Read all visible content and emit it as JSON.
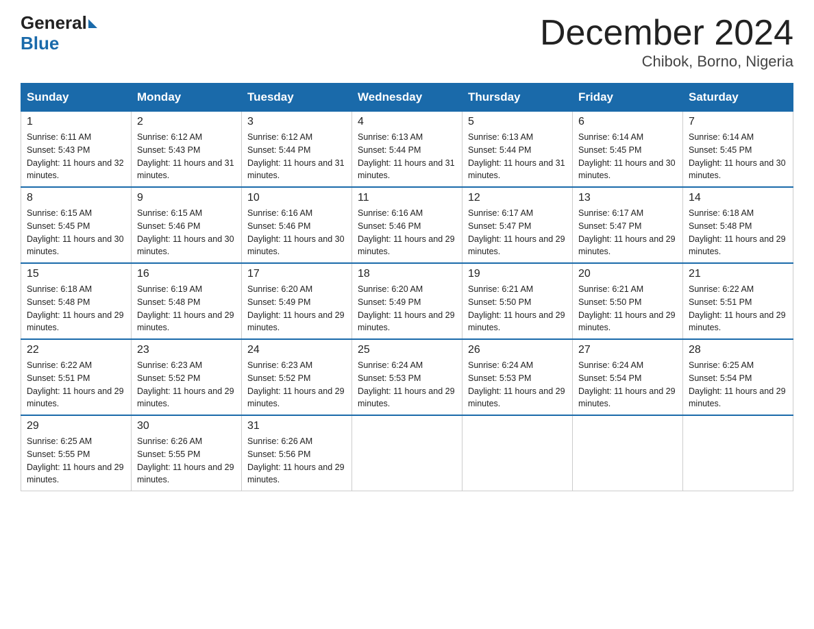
{
  "header": {
    "logo_general": "General",
    "logo_blue": "Blue",
    "month_title": "December 2024",
    "location": "Chibok, Borno, Nigeria"
  },
  "days_of_week": [
    "Sunday",
    "Monday",
    "Tuesday",
    "Wednesday",
    "Thursday",
    "Friday",
    "Saturday"
  ],
  "weeks": [
    [
      {
        "day": "1",
        "sunrise": "6:11 AM",
        "sunset": "5:43 PM",
        "daylight": "11 hours and 32 minutes."
      },
      {
        "day": "2",
        "sunrise": "6:12 AM",
        "sunset": "5:43 PM",
        "daylight": "11 hours and 31 minutes."
      },
      {
        "day": "3",
        "sunrise": "6:12 AM",
        "sunset": "5:44 PM",
        "daylight": "11 hours and 31 minutes."
      },
      {
        "day": "4",
        "sunrise": "6:13 AM",
        "sunset": "5:44 PM",
        "daylight": "11 hours and 31 minutes."
      },
      {
        "day": "5",
        "sunrise": "6:13 AM",
        "sunset": "5:44 PM",
        "daylight": "11 hours and 31 minutes."
      },
      {
        "day": "6",
        "sunrise": "6:14 AM",
        "sunset": "5:45 PM",
        "daylight": "11 hours and 30 minutes."
      },
      {
        "day": "7",
        "sunrise": "6:14 AM",
        "sunset": "5:45 PM",
        "daylight": "11 hours and 30 minutes."
      }
    ],
    [
      {
        "day": "8",
        "sunrise": "6:15 AM",
        "sunset": "5:45 PM",
        "daylight": "11 hours and 30 minutes."
      },
      {
        "day": "9",
        "sunrise": "6:15 AM",
        "sunset": "5:46 PM",
        "daylight": "11 hours and 30 minutes."
      },
      {
        "day": "10",
        "sunrise": "6:16 AM",
        "sunset": "5:46 PM",
        "daylight": "11 hours and 30 minutes."
      },
      {
        "day": "11",
        "sunrise": "6:16 AM",
        "sunset": "5:46 PM",
        "daylight": "11 hours and 29 minutes."
      },
      {
        "day": "12",
        "sunrise": "6:17 AM",
        "sunset": "5:47 PM",
        "daylight": "11 hours and 29 minutes."
      },
      {
        "day": "13",
        "sunrise": "6:17 AM",
        "sunset": "5:47 PM",
        "daylight": "11 hours and 29 minutes."
      },
      {
        "day": "14",
        "sunrise": "6:18 AM",
        "sunset": "5:48 PM",
        "daylight": "11 hours and 29 minutes."
      }
    ],
    [
      {
        "day": "15",
        "sunrise": "6:18 AM",
        "sunset": "5:48 PM",
        "daylight": "11 hours and 29 minutes."
      },
      {
        "day": "16",
        "sunrise": "6:19 AM",
        "sunset": "5:48 PM",
        "daylight": "11 hours and 29 minutes."
      },
      {
        "day": "17",
        "sunrise": "6:20 AM",
        "sunset": "5:49 PM",
        "daylight": "11 hours and 29 minutes."
      },
      {
        "day": "18",
        "sunrise": "6:20 AM",
        "sunset": "5:49 PM",
        "daylight": "11 hours and 29 minutes."
      },
      {
        "day": "19",
        "sunrise": "6:21 AM",
        "sunset": "5:50 PM",
        "daylight": "11 hours and 29 minutes."
      },
      {
        "day": "20",
        "sunrise": "6:21 AM",
        "sunset": "5:50 PM",
        "daylight": "11 hours and 29 minutes."
      },
      {
        "day": "21",
        "sunrise": "6:22 AM",
        "sunset": "5:51 PM",
        "daylight": "11 hours and 29 minutes."
      }
    ],
    [
      {
        "day": "22",
        "sunrise": "6:22 AM",
        "sunset": "5:51 PM",
        "daylight": "11 hours and 29 minutes."
      },
      {
        "day": "23",
        "sunrise": "6:23 AM",
        "sunset": "5:52 PM",
        "daylight": "11 hours and 29 minutes."
      },
      {
        "day": "24",
        "sunrise": "6:23 AM",
        "sunset": "5:52 PM",
        "daylight": "11 hours and 29 minutes."
      },
      {
        "day": "25",
        "sunrise": "6:24 AM",
        "sunset": "5:53 PM",
        "daylight": "11 hours and 29 minutes."
      },
      {
        "day": "26",
        "sunrise": "6:24 AM",
        "sunset": "5:53 PM",
        "daylight": "11 hours and 29 minutes."
      },
      {
        "day": "27",
        "sunrise": "6:24 AM",
        "sunset": "5:54 PM",
        "daylight": "11 hours and 29 minutes."
      },
      {
        "day": "28",
        "sunrise": "6:25 AM",
        "sunset": "5:54 PM",
        "daylight": "11 hours and 29 minutes."
      }
    ],
    [
      {
        "day": "29",
        "sunrise": "6:25 AM",
        "sunset": "5:55 PM",
        "daylight": "11 hours and 29 minutes."
      },
      {
        "day": "30",
        "sunrise": "6:26 AM",
        "sunset": "5:55 PM",
        "daylight": "11 hours and 29 minutes."
      },
      {
        "day": "31",
        "sunrise": "6:26 AM",
        "sunset": "5:56 PM",
        "daylight": "11 hours and 29 minutes."
      },
      null,
      null,
      null,
      null
    ]
  ]
}
